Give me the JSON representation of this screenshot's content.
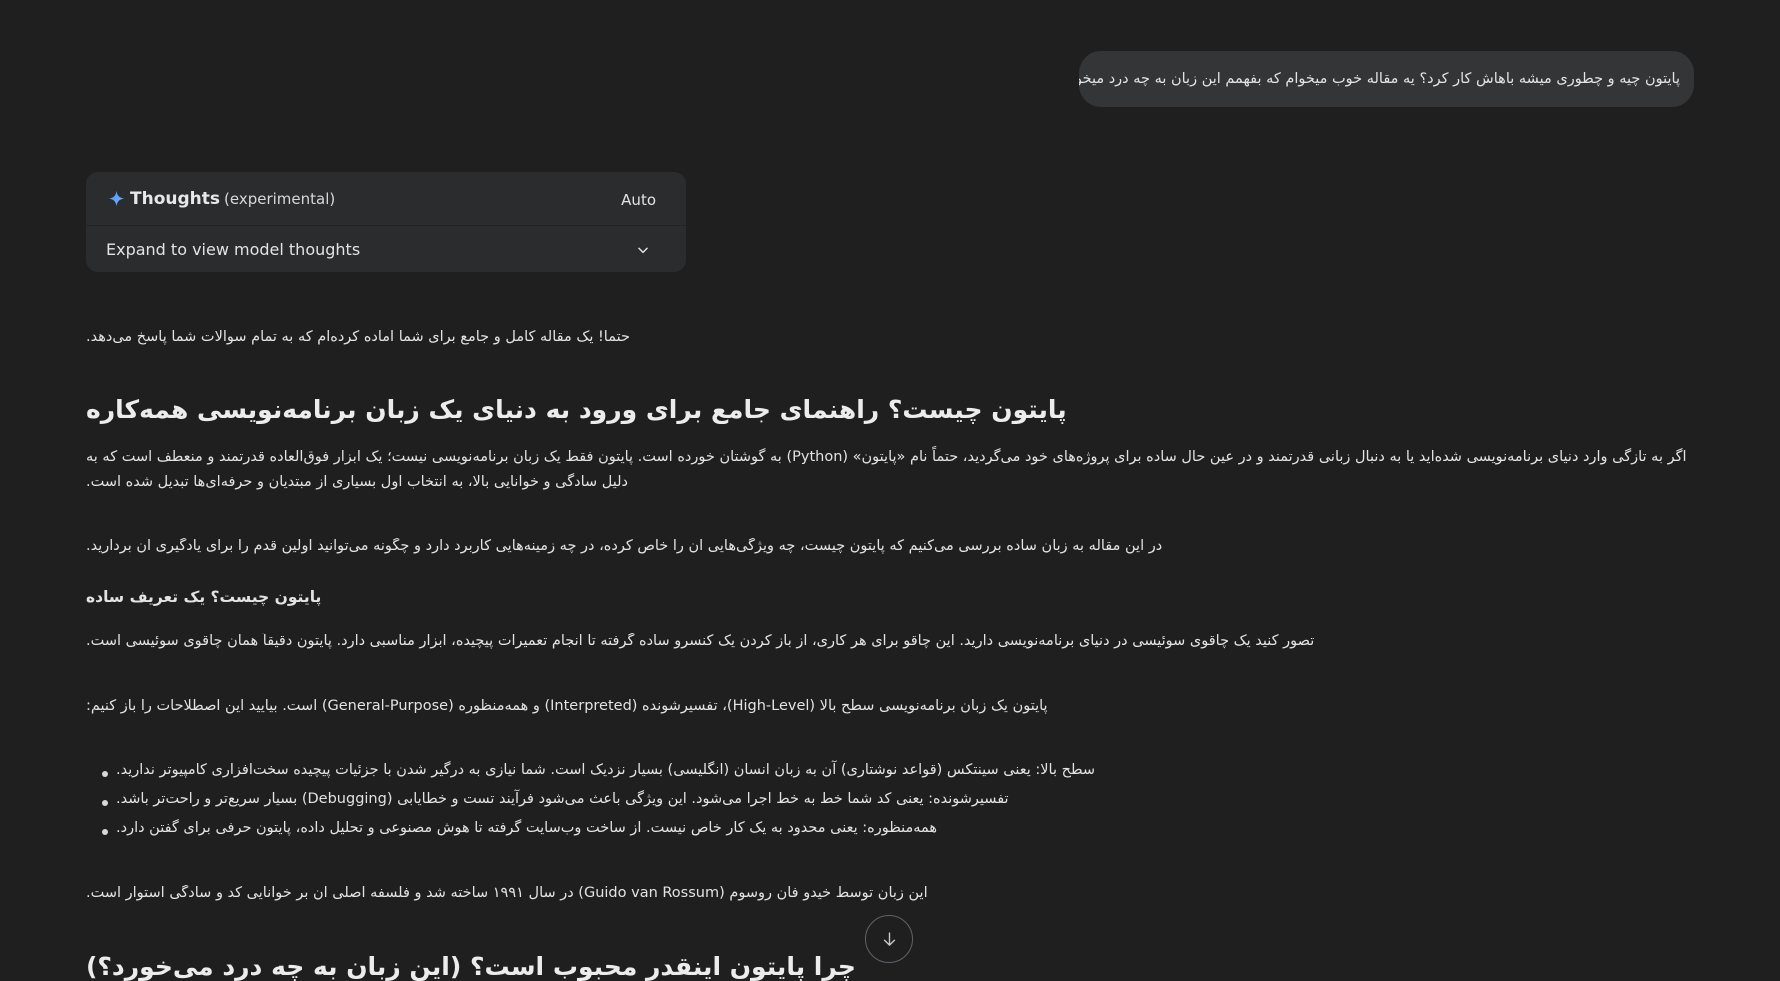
{
  "user_prompt": "پایتون چیه و چطوری میشه باهاش کار کرد؟ یه مقاله خوب میخوام که بفهمم این زبان به چه درد میخوره؟",
  "thoughts_panel": {
    "title": "Thoughts",
    "subtitle": "(experimental)",
    "mode": "Auto",
    "expand_label": "Expand to view model thoughts"
  },
  "response": {
    "intro": "حتما! یک مقاله کامل و جامع برای شما آماده کرده‌ام که به تمام سوالات شما پاسخ می‌دهد.",
    "heading_main": "پایتون چیست؟ راهنمای جامع برای ورود به دنیای یک زبان برنامه‌نویسی همه‌کاره",
    "para_1": "اگر به تازگی وارد دنیای برنامه‌نویسی شده‌اید یا به دنبال زبانی قدرتمند و در عین حال ساده برای پروژه‌های خود می‌گردید، حتماً نام «پایتون» (Python) به گوشتان خورده است. پایتون فقط یک زبان برنامه‌نویسی نیست؛ یک ابزار فوق‌العاده قدرتمند و منعطف است که به دلیل سادگی و خوانایی بالا، به انتخاب اول بسیاری از مبتدیان و حرفه‌ای‌ها تبدیل شده است.",
    "para_2": "در این مقاله به زبان ساده بررسی می‌کنیم که پایتون چیست، چه ویژگی‌هایی آن را خاص کرده، در چه زمینه‌هایی کاربرد دارد و چگونه می‌توانید اولین قدم را برای یادگیری آن بردارید.",
    "heading_definition": "پایتون چیست؟ یک تعریف ساده",
    "para_3": "تصور کنید یک چاقوی سوئیسی در دنیای برنامه‌نویسی دارید. این چاقو برای هر کاری، از باز کردن یک کنسرو ساده گرفته تا انجام تعمیرات پیچیده، ابزار مناسبی دارد. پایتون دقیقاً همان چاقوی سوئیسی است.",
    "para_4": "پایتون یک زبان برنامه‌نویسی سطح بالا (High-Level)، تفسیرشونده (Interpreted) و همه‌منظوره (General-Purpose) است. بیایید این اصطلاحات را باز کنیم:",
    "bullets": [
      "سطح بالا: یعنی سینتکس (قواعد نوشتاری) آن به زبان انسان (انگلیسی) بسیار نزدیک است. شما نیازی به درگیر شدن با جزئیات پیچیده سخت‌افزاری کامپیوتر ندارید.",
      "تفسیرشونده: یعنی کد شما خط به خط اجرا می‌شود. این ویژگی باعث می‌شود فرآیند تست و خطایابی (Debugging) بسیار سریع‌تر و راحت‌تر باشد.",
      "همه‌منظوره: یعنی محدود به یک کار خاص نیست. از ساخت وب‌سایت گرفته تا هوش مصنوعی و تحلیل داده، پایتون حرفی برای گفتن دارد."
    ],
    "para_5": "این زبان توسط خیدو فان روسوم (Guido van Rossum) در سال ۱۹۹۱ ساخته شد و فلسفه اصلی آن بر خوانایی کد و سادگی استوار است.",
    "heading_popular": "چرا پایتون اینقدر محبوب است؟ (این زبان به چه درد می‌خورد؟)"
  },
  "colors": {
    "background": "#1f1f20",
    "bubble": "#333537",
    "card": "#2b2c2e",
    "accent": "#4b8df8"
  },
  "icons": {
    "sparkle": "sparkle-icon",
    "chevron": "chevron-down-icon",
    "scroll": "arrow-down-icon"
  }
}
